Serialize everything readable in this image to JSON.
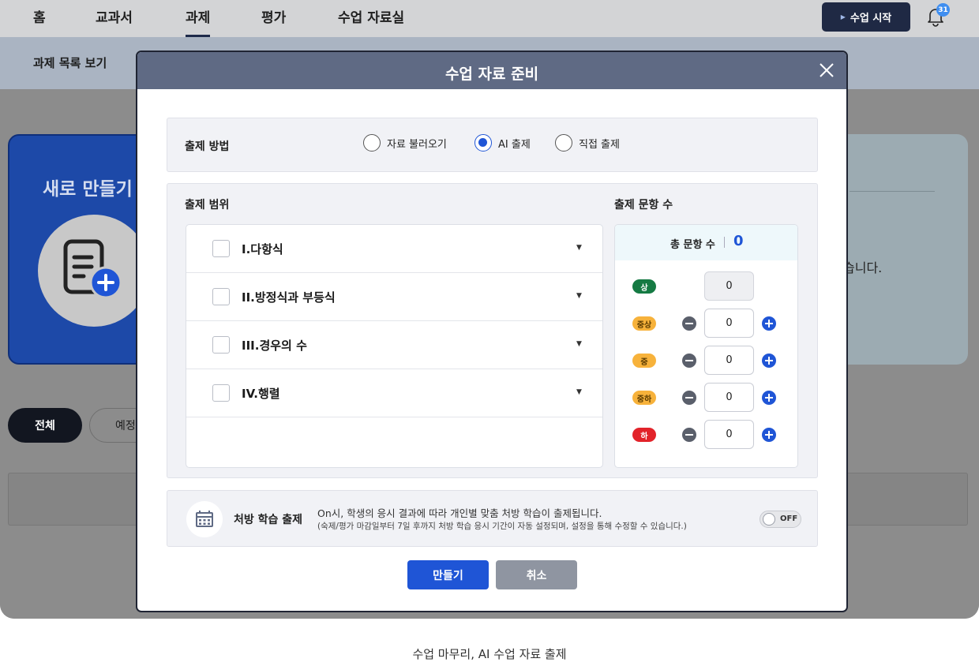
{
  "nav": {
    "items": [
      "홈",
      "교과서",
      "과제",
      "평가",
      "수업 자료실"
    ],
    "start_label": "수업 시작",
    "notification_count": "31"
  },
  "subbar": {
    "title": "과제 목록 보기"
  },
  "background": {
    "new_card_title": "새로 만들기",
    "right_text": "습니다.",
    "filter_all": "전체",
    "filter_scheduled": "예정"
  },
  "modal": {
    "title": "수업 자료 준비",
    "method": {
      "label": "출제 방법",
      "options": [
        "자료 불러오기",
        "AI 출제",
        "직접 출제"
      ],
      "selected": "AI 출제"
    },
    "range": {
      "label": "출제 범위",
      "units": [
        "I.다항식",
        "II.방정식과 부등식",
        "III.경우의 수",
        "IV.행렬"
      ]
    },
    "count": {
      "label": "출제 문항 수",
      "total_label": "총 문항 수",
      "total_value": "0",
      "levels": [
        {
          "name": "상",
          "value": "0",
          "color": "#157a43",
          "text_color": "#ffffff"
        },
        {
          "name": "중상",
          "value": "0",
          "color": "#f7b23b",
          "text_color": "#5a3a00"
        },
        {
          "name": "중",
          "value": "0",
          "color": "#f7b23b",
          "text_color": "#5a3a00"
        },
        {
          "name": "중하",
          "value": "0",
          "color": "#f7b23b",
          "text_color": "#5a3a00"
        },
        {
          "name": "하",
          "value": "0",
          "color": "#e2232a",
          "text_color": "#ffffff"
        }
      ]
    },
    "prescription": {
      "label": "처방 학습 출제",
      "desc1": "On시, 학생의 응시 결과에 따라 개인별 맞춤 처방 학습이 출제됩니다.",
      "desc2": "(숙제/평가 마감일부터 7일 후까지 처방 학습 응시 기간이 자동 설정되며, 설정을 통해 수정할 수 있습니다.)",
      "toggle": "OFF"
    },
    "buttons": {
      "create": "만들기",
      "cancel": "취소"
    }
  },
  "caption": "수업 마무리, AI 수업 자료 출제",
  "colors": {
    "primary": "#1f55d6",
    "header": "#5f6a84",
    "nav_dark": "#1f2944"
  }
}
